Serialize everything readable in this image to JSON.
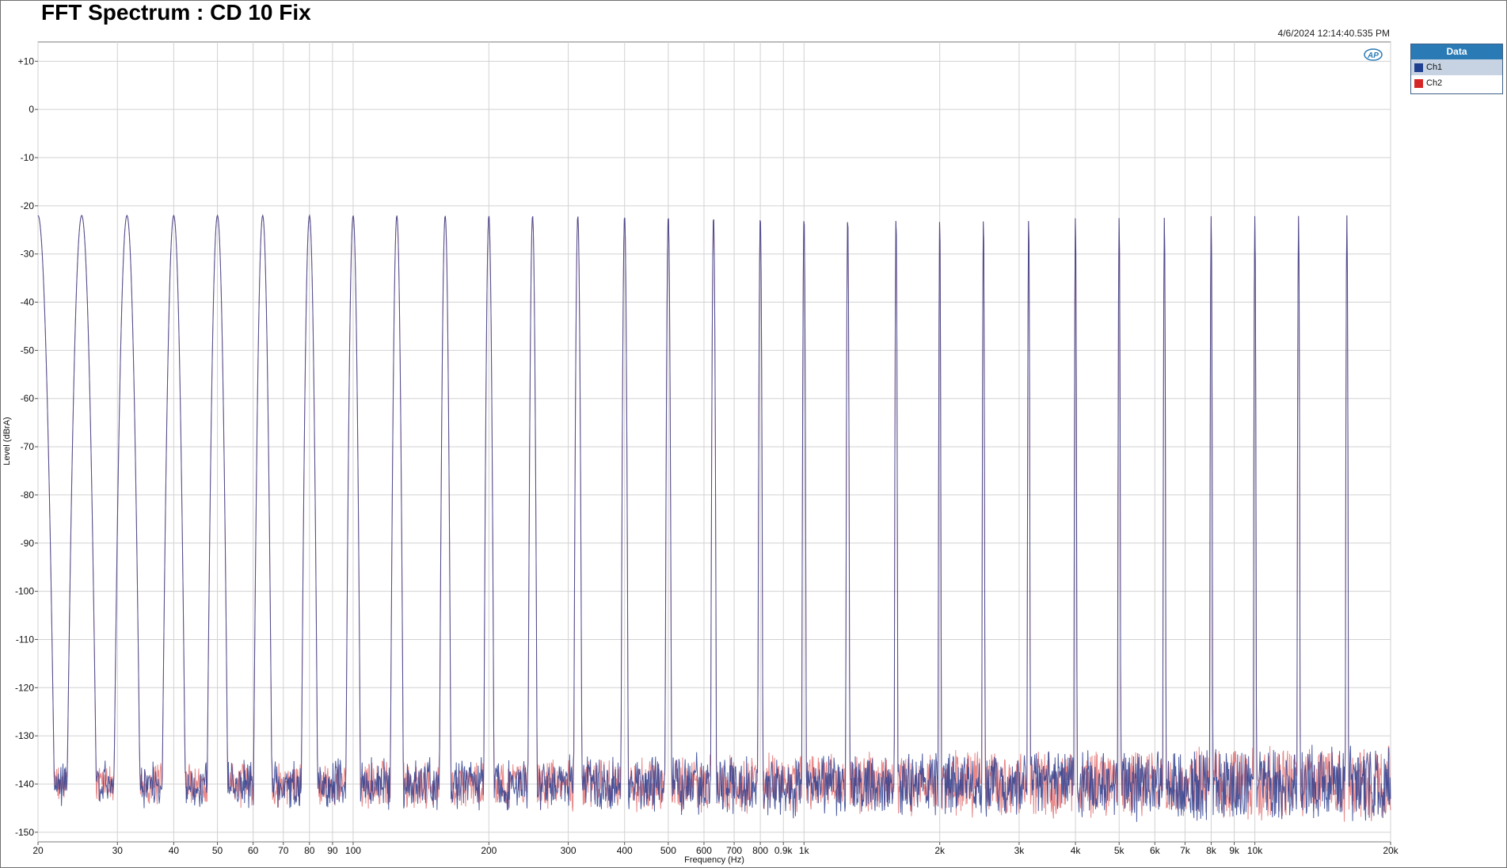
{
  "title": "FFT Spectrum : CD 10 Fix",
  "timestamp": "4/6/2024 12:14:40.535 PM",
  "logo_text": "AP",
  "legend": {
    "title": "Data",
    "items": [
      {
        "label": "Ch1",
        "color": "#1f3f8f"
      },
      {
        "label": "Ch2",
        "color": "#d62728"
      }
    ]
  },
  "chart_data": {
    "type": "line",
    "title": "FFT Spectrum : CD 10 Fix",
    "xlabel": "Frequency (Hz)",
    "ylabel": "Level (dBrA)",
    "xscale": "log",
    "xlim": [
      20,
      20000
    ],
    "ylim": [
      -152,
      14
    ],
    "grid": true,
    "legend_position": "right, outside plot",
    "y_ticks": [
      {
        "value": 10,
        "label": "+10"
      },
      {
        "value": 0,
        "label": "0"
      },
      {
        "value": -10,
        "label": "-10"
      },
      {
        "value": -20,
        "label": "-20"
      },
      {
        "value": -30,
        "label": "-30"
      },
      {
        "value": -40,
        "label": "-40"
      },
      {
        "value": -50,
        "label": "-50"
      },
      {
        "value": -60,
        "label": "-60"
      },
      {
        "value": -70,
        "label": "-70"
      },
      {
        "value": -80,
        "label": "-80"
      },
      {
        "value": -90,
        "label": "-90"
      },
      {
        "value": -100,
        "label": "-100"
      },
      {
        "value": -110,
        "label": "-110"
      },
      {
        "value": -120,
        "label": "-120"
      },
      {
        "value": -130,
        "label": "-130"
      },
      {
        "value": -140,
        "label": "-140"
      },
      {
        "value": -150,
        "label": "-150"
      }
    ],
    "x_ticks": [
      {
        "value": 20,
        "label": "20"
      },
      {
        "value": 30,
        "label": "30"
      },
      {
        "value": 40,
        "label": "40"
      },
      {
        "value": 50,
        "label": "50"
      },
      {
        "value": 60,
        "label": "60"
      },
      {
        "value": 70,
        "label": "70"
      },
      {
        "value": 80,
        "label": "80"
      },
      {
        "value": 90,
        "label": "90"
      },
      {
        "value": 100,
        "label": "100"
      },
      {
        "value": 200,
        "label": "200"
      },
      {
        "value": 300,
        "label": "300"
      },
      {
        "value": 400,
        "label": "400"
      },
      {
        "value": 500,
        "label": "500"
      },
      {
        "value": 600,
        "label": "600"
      },
      {
        "value": 700,
        "label": "700"
      },
      {
        "value": 800,
        "label": "800"
      },
      {
        "value": 900,
        "label": "0.9k"
      },
      {
        "value": 1000,
        "label": "1k"
      },
      {
        "value": 2000,
        "label": "2k"
      },
      {
        "value": 3000,
        "label": "3k"
      },
      {
        "value": 4000,
        "label": "4k"
      },
      {
        "value": 5000,
        "label": "5k"
      },
      {
        "value": 6000,
        "label": "6k"
      },
      {
        "value": 7000,
        "label": "7k"
      },
      {
        "value": 8000,
        "label": "8k"
      },
      {
        "value": 9000,
        "label": "9k"
      },
      {
        "value": 10000,
        "label": "10k"
      },
      {
        "value": 20000,
        "label": "20k"
      }
    ],
    "noise_floor_db": -140,
    "tones_hz": [
      20,
      25,
      31.5,
      40,
      50,
      63,
      80,
      100,
      125,
      160,
      200,
      250,
      315,
      400,
      500,
      630,
      800,
      1000,
      1250,
      1600,
      2000,
      2500,
      3150,
      4000,
      5000,
      6300,
      8000,
      10000,
      12500,
      16000
    ],
    "tone_levels_db": [
      -22,
      -22,
      -22,
      -22,
      -22,
      -22,
      -22,
      -22,
      -22,
      -22,
      -22,
      -22,
      -22,
      -22,
      -22,
      -22,
      -22,
      -22,
      -22,
      -22,
      -22,
      -22,
      -22,
      -22,
      -22,
      -22,
      -22,
      -22,
      -22,
      -22
    ],
    "series": [
      {
        "name": "Ch1",
        "color": "#2f3f8f"
      },
      {
        "name": "Ch2",
        "color": "#d62728"
      }
    ]
  }
}
